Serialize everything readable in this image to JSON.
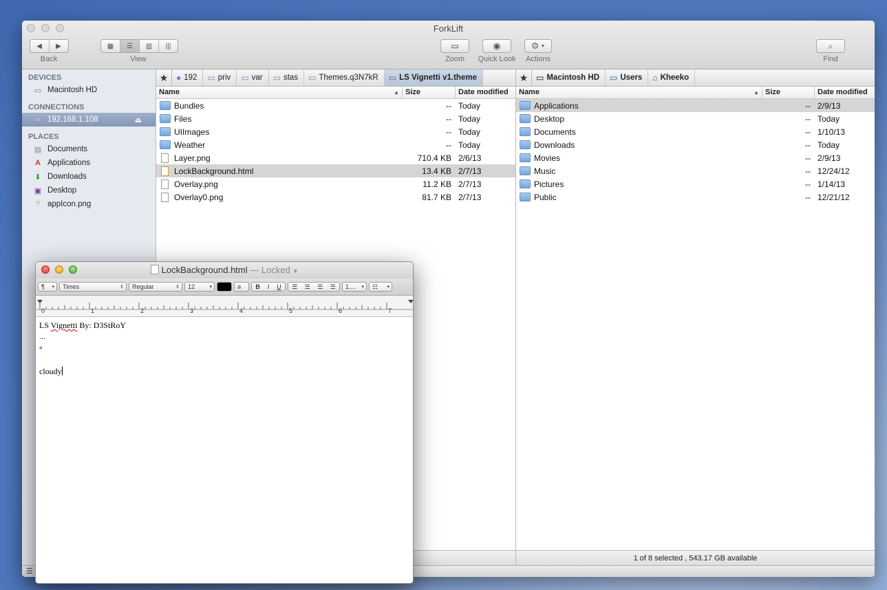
{
  "app": {
    "title": "ForkLift"
  },
  "toolbar": {
    "back_label": "Back",
    "view_label": "View",
    "zoom_label": "Zoom",
    "quicklook_label": "Quick Look",
    "actions_label": "Actions",
    "find_label": "Find"
  },
  "sidebar": {
    "devices_head": "DEVICES",
    "devices": [
      {
        "label": "Macintosh HD",
        "icon": "hard-drive-icon"
      }
    ],
    "connections_head": "CONNECTIONS",
    "connections": [
      {
        "label": "192.168.1.108",
        "icon": "network-globe-icon",
        "selected": true
      }
    ],
    "places_head": "PLACES",
    "places": [
      {
        "label": "Documents",
        "icon": "documents-icon"
      },
      {
        "label": "Applications",
        "icon": "applications-icon"
      },
      {
        "label": "Downloads",
        "icon": "downloads-icon"
      },
      {
        "label": "Desktop",
        "icon": "desktop-icon"
      },
      {
        "label": "appIcon.png",
        "icon": "unknown-file-icon"
      }
    ]
  },
  "left_pane": {
    "path": [
      "192",
      "priv",
      "var",
      "stas",
      "Themes.q3N7kR",
      "LS Vignetti v1.theme"
    ],
    "columns": {
      "name": "Name",
      "size": "Size",
      "date": "Date modified"
    },
    "rows": [
      {
        "name": "Bundles",
        "size": "--",
        "date": "Today",
        "kind": "folder"
      },
      {
        "name": "Files",
        "size": "--",
        "date": "Today",
        "kind": "folder"
      },
      {
        "name": "UIImages",
        "size": "--",
        "date": "Today",
        "kind": "folder"
      },
      {
        "name": "Weather",
        "size": "--",
        "date": "Today",
        "kind": "folder"
      },
      {
        "name": "Layer.png",
        "size": "710.4 KB",
        "date": "2/6/13",
        "kind": "file"
      },
      {
        "name": "LockBackground.html",
        "size": "13.4 KB",
        "date": "2/7/13",
        "kind": "html",
        "selected": true
      },
      {
        "name": "Overlay.png",
        "size": "11.2 KB",
        "date": "2/7/13",
        "kind": "file"
      },
      {
        "name": "Overlay0.png",
        "size": "81.7 KB",
        "date": "2/7/13",
        "kind": "file"
      }
    ]
  },
  "right_pane": {
    "path": [
      "Macintosh HD",
      "Users",
      "Kheeko"
    ],
    "columns": {
      "name": "Name",
      "size": "Size",
      "date": "Date modified"
    },
    "rows": [
      {
        "name": "Applications",
        "size": "--",
        "date": "2/9/13",
        "selected": true
      },
      {
        "name": "Desktop",
        "size": "--",
        "date": "Today"
      },
      {
        "name": "Documents",
        "size": "--",
        "date": "1/10/13"
      },
      {
        "name": "Downloads",
        "size": "--",
        "date": "Today"
      },
      {
        "name": "Movies",
        "size": "--",
        "date": "2/9/13"
      },
      {
        "name": "Music",
        "size": "--",
        "date": "12/24/12"
      },
      {
        "name": "Pictures",
        "size": "--",
        "date": "1/14/13"
      },
      {
        "name": "Public",
        "size": "--",
        "date": "12/21/12"
      }
    ],
    "status": "1 of 8 selected , 543.17 GB available"
  },
  "textedit": {
    "filename": "LockBackground.html",
    "locked": "— Locked",
    "font_family": "Times",
    "font_style": "Regular",
    "font_size": "12",
    "spacing": "1....",
    "ruler_numbers": [
      "0",
      "1",
      "2",
      "3",
      "4",
      "5",
      "6",
      "7"
    ],
    "lines": [
      "LS Vignetti By: D3StRoY",
      "...",
      "°",
      "",
      "cloudy"
    ]
  },
  "colors": {
    "selected_sidebar": "#8497b6",
    "selected_row": "#d5d5d5",
    "folder_blue": "#77a6dd"
  }
}
